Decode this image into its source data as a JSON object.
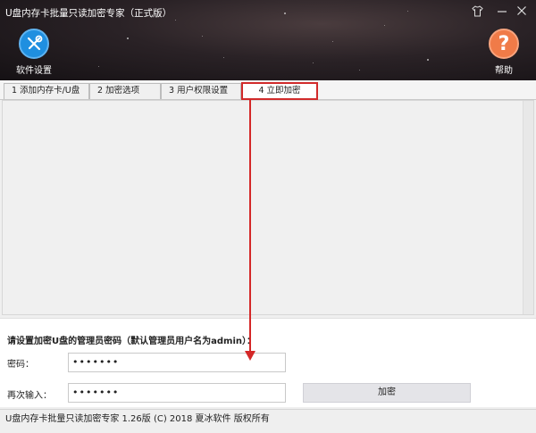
{
  "window": {
    "title": "U盘内存卡批量只读加密专家（正式版）",
    "controls": [
      "shirt-icon",
      "minimize-icon",
      "close-icon"
    ]
  },
  "toolbar": {
    "settings_label": "软件设置",
    "help_label": "帮助",
    "help_glyph": "?"
  },
  "tabs": [
    {
      "label": "1 添加内存卡/U盘"
    },
    {
      "label": "2 加密选项"
    },
    {
      "label": "3 用户权限设置"
    },
    {
      "label": "4 立即加密",
      "active": true
    }
  ],
  "form": {
    "prompt": "请设置加密U盘的管理员密码（默认管理员用户名为admin）：",
    "password_label": "密码：",
    "password_value": "•••••••",
    "confirm_label": "再次输入：",
    "confirm_value": "•••••••",
    "encrypt_button": "加密"
  },
  "status": {
    "text": "U盘内存卡批量只读加密专家 1.26版 (C) 2018 夏冰软件 版权所有"
  },
  "colors": {
    "accent_red": "#d42828",
    "settings_blue": "#1f8fe0",
    "help_orange": "#f07b48"
  }
}
